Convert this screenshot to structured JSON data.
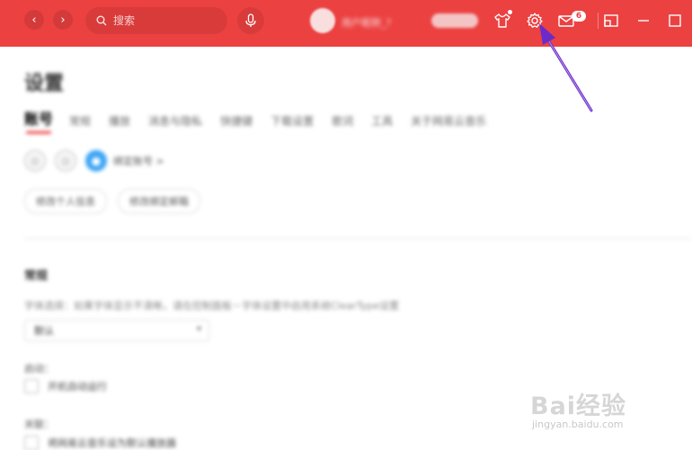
{
  "colors": {
    "brand": "#ec4141",
    "accent_blue": "#3ea6f5",
    "divider": "#e3e3e3"
  },
  "titlebar": {
    "back_icon": "chevron-left-icon",
    "forward_icon": "chevron-right-icon",
    "search": {
      "placeholder": "搜索",
      "value": ""
    },
    "mic_icon": "microphone-icon",
    "user": {
      "name": "用户昵称_?",
      "vip_prefix": "",
      "vip_label": ""
    },
    "icons": [
      "tshirt-skin-icon",
      "gear-icon",
      "mail-icon",
      "mini-mode-icon",
      "minimize-icon",
      "maximize-icon"
    ],
    "mail_count": "6"
  },
  "settings": {
    "title": "设置",
    "tabs": [
      {
        "label": "账号",
        "active": true
      },
      {
        "label": "常规"
      },
      {
        "label": "播放"
      },
      {
        "label": "消息与隐私"
      },
      {
        "label": "快捷键"
      },
      {
        "label": "下载设置"
      },
      {
        "label": "歌词"
      },
      {
        "label": "工具"
      },
      {
        "label": "关于网易云音乐"
      }
    ],
    "account": {
      "bind_label": "绑定账号 >",
      "buttons": [
        "修改个人信息",
        "修改绑定邮箱"
      ]
    },
    "general": {
      "heading": "常规",
      "font_desc": "字体选择：如果字体显示不清晰，请在控制面板－字体设置中启用系统ClearType设置",
      "font_value": "默认",
      "startup_label": "启动：",
      "startup_check": "开机自动运行",
      "association_label": "关联：",
      "association_check": "将网易云音乐设为默认播放器"
    }
  },
  "annotation": {
    "arrow_icon": "purple-arrow-icon"
  },
  "watermark": {
    "brand": "Bai经验",
    "url": "jingyan.baidu.com"
  }
}
